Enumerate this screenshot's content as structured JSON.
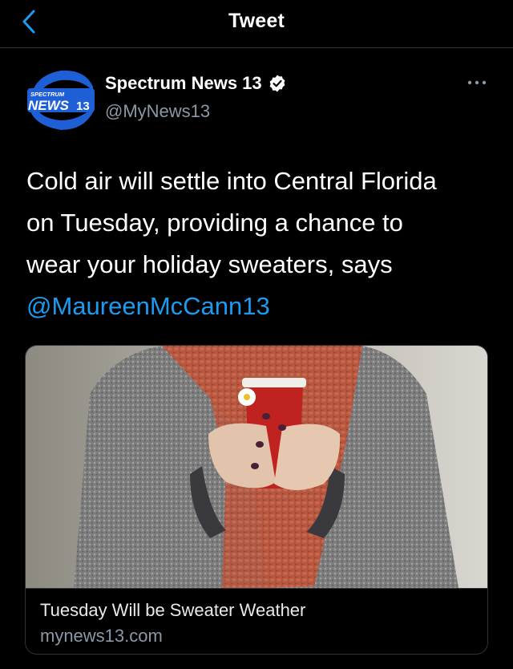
{
  "header": {
    "title": "Tweet",
    "back_icon": "chevron-left-icon"
  },
  "author": {
    "name": "Spectrum News 13",
    "handle": "@MyNews13",
    "verified": true,
    "verified_icon": "verified-badge-icon",
    "avatar_logo_text": "SPECTRUM NEWS 13"
  },
  "more_icon": "more-horizontal-icon",
  "tweet": {
    "text_line1": "Cold air will settle into Central Florida",
    "text_line2": "on Tuesday, providing a chance to",
    "text_line3": "wear your holiday sweaters, says",
    "mention": "@MaureenMcCann13"
  },
  "card": {
    "title": "Tuesday Will be Sweater Weather",
    "domain": "mynews13.com",
    "image_subject": "person in grey sweater and rust scarf holding red coffee cup with a daisy"
  },
  "colors": {
    "background": "#000000",
    "text": "#ffffff",
    "secondary_text": "#8b98a5",
    "link": "#1d9bf0",
    "verified": "#ffffff",
    "divider": "#2f3336",
    "logo_blue": "#1f5fd6"
  }
}
